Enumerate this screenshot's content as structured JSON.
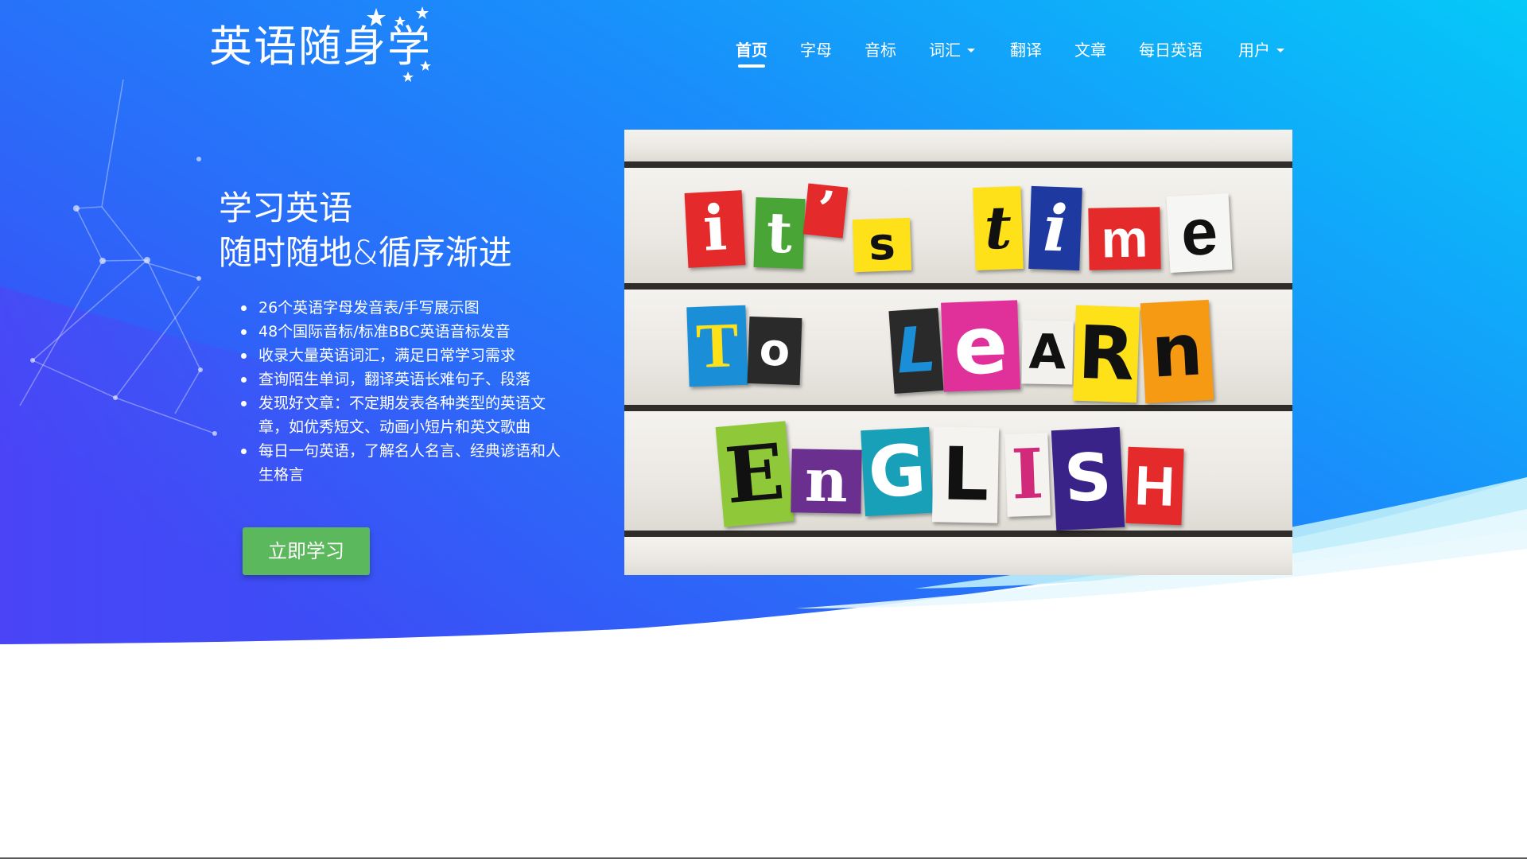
{
  "brand": {
    "logo_text": "英语随身学",
    "colors": {
      "bg_start": "#3a4cf6",
      "bg_end": "#05c9f8",
      "cta": "#5cb85c",
      "wave_light": "#bfeefb"
    }
  },
  "nav": {
    "items": [
      {
        "label": "首页",
        "active": true
      },
      {
        "label": "字母"
      },
      {
        "label": "音标"
      },
      {
        "label": "词汇",
        "dropdown": true
      },
      {
        "label": "翻译"
      },
      {
        "label": "文章"
      },
      {
        "label": "每日英语"
      },
      {
        "label": "用户",
        "dropdown": true
      }
    ]
  },
  "hero": {
    "title_line1": "学习英语",
    "title_line2": "随时随地&循序渐进",
    "features": [
      "26个英语字母发音表/手写展示图",
      "48个国际音标/标准BBC英语音标发音",
      "收录大量英语词汇，满足日常学习需求",
      "查询陌生单词，翻译英语长难句子、段落",
      "发现好文章：不定期发表各种类型的英语文章，如优秀短文、动画小短片和英文歌曲",
      "每日一句英语，了解名人名言、经典谚语和人生格言"
    ],
    "cta_label": "立即学习"
  },
  "image": {
    "row1": [
      "i",
      "t",
      "’",
      "s",
      "t",
      "i",
      "m",
      "e"
    ],
    "row2": [
      "T",
      "o",
      "L",
      "e",
      "A",
      "R",
      "n"
    ],
    "row3": [
      "E",
      "n",
      "G",
      "L",
      "I",
      "S",
      "H"
    ]
  }
}
